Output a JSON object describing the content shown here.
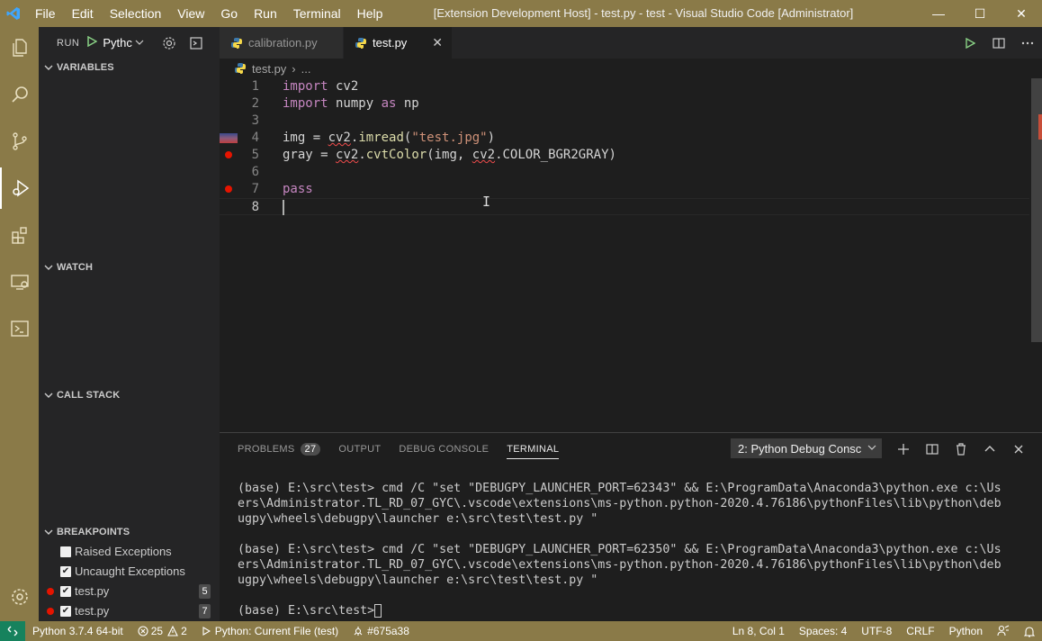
{
  "titlebar": {
    "menu": [
      "File",
      "Edit",
      "Selection",
      "View",
      "Go",
      "Run",
      "Terminal",
      "Help"
    ],
    "title": "[Extension Development Host] - test.py - test - Visual Studio Code [Administrator]",
    "minimize": "—",
    "maximize": "☐",
    "close": "✕"
  },
  "activity_bar": [
    "explorer-icon",
    "search-icon",
    "source-control-icon",
    "run-debug-icon",
    "extensions-icon",
    "remote-explorer-icon",
    "terminal-icon",
    "settings-gear-icon"
  ],
  "sidebar": {
    "run_label": "RUN",
    "config_name": "Pythc",
    "sections": {
      "variables": "VARIABLES",
      "watch": "WATCH",
      "call_stack": "CALL STACK",
      "breakpoints": "BREAKPOINTS"
    },
    "breakpoints": [
      {
        "label": "Raised Exceptions",
        "checked": false,
        "line": ""
      },
      {
        "label": "Uncaught Exceptions",
        "checked": true,
        "line": ""
      },
      {
        "label": "test.py",
        "checked": true,
        "line": "5"
      },
      {
        "label": "test.py",
        "checked": true,
        "line": "7"
      }
    ]
  },
  "tabs": [
    {
      "label": "calibration.py",
      "active": false
    },
    {
      "label": "test.py",
      "active": true,
      "close": "✕"
    }
  ],
  "breadcrumb": {
    "file": "test.py",
    "sep": "›",
    "rest": "..."
  },
  "editor": {
    "line_numbers": [
      "1",
      "2",
      "3",
      "4",
      "5",
      "6",
      "7",
      "8"
    ],
    "lines": {
      "l1": {
        "kw": "import",
        "rest": " cv2"
      },
      "l2": {
        "kw1": "import",
        "mid": " numpy ",
        "kw2": "as",
        "rest": " np"
      },
      "l4": {
        "a": "img = ",
        "b": "cv2",
        "c": ".",
        "fn": "imread",
        "d": "(",
        "str": "\"test.jpg\"",
        "e": ")"
      },
      "l5": {
        "a": "gray = ",
        "b": "cv2",
        "c": ".",
        "fn": "cvtColor",
        "d": "(img, ",
        "e": "cv2",
        "f": ".COLOR_BGR2GRAY)"
      },
      "l7": {
        "kw": "pass"
      }
    }
  },
  "panel": {
    "tabs": {
      "problems": "PROBLEMS",
      "problems_count": "27",
      "output": "OUTPUT",
      "debug_console": "DEBUG CONSOLE",
      "terminal": "TERMINAL"
    },
    "terminal_select": "2: Python Debug Consc",
    "terminal_lines": [
      "(base) E:\\src\\test> cmd /C \"set \"DEBUGPY_LAUNCHER_PORT=62343\" && E:\\ProgramData\\Anaconda3\\python.exe c:\\Us",
      "ers\\Administrator.TL_RD_07_GYC\\.vscode\\extensions\\ms-python.python-2020.4.76186\\pythonFiles\\lib\\python\\deb",
      "ugpy\\wheels\\debugpy\\launcher e:\\src\\test\\test.py \"",
      "",
      "(base) E:\\src\\test> cmd /C \"set \"DEBUGPY_LAUNCHER_PORT=62350\" && E:\\ProgramData\\Anaconda3\\python.exe c:\\Us",
      "ers\\Administrator.TL_RD_07_GYC\\.vscode\\extensions\\ms-python.python-2020.4.76186\\pythonFiles\\lib\\python\\deb",
      "ugpy\\wheels\\debugpy\\launcher e:\\src\\test\\test.py \"",
      ""
    ],
    "prompt": "(base) E:\\src\\test>"
  },
  "statusbar": {
    "interpreter": "Python 3.7.4 64-bit",
    "errors": "25",
    "warnings": "2",
    "debug_config": "Python: Current File (test)",
    "commit": "#675a38",
    "position": "Ln 8, Col 1",
    "spaces": "Spaces: 4",
    "encoding": "UTF-8",
    "eol": "CRLF",
    "language": "Python"
  },
  "colors": {
    "accent": "#8a7a48",
    "remote": "#16825d",
    "breakpoint": "#e51400",
    "keyword": "#c586c0",
    "string": "#ce9178",
    "function": "#dcdcaa"
  }
}
